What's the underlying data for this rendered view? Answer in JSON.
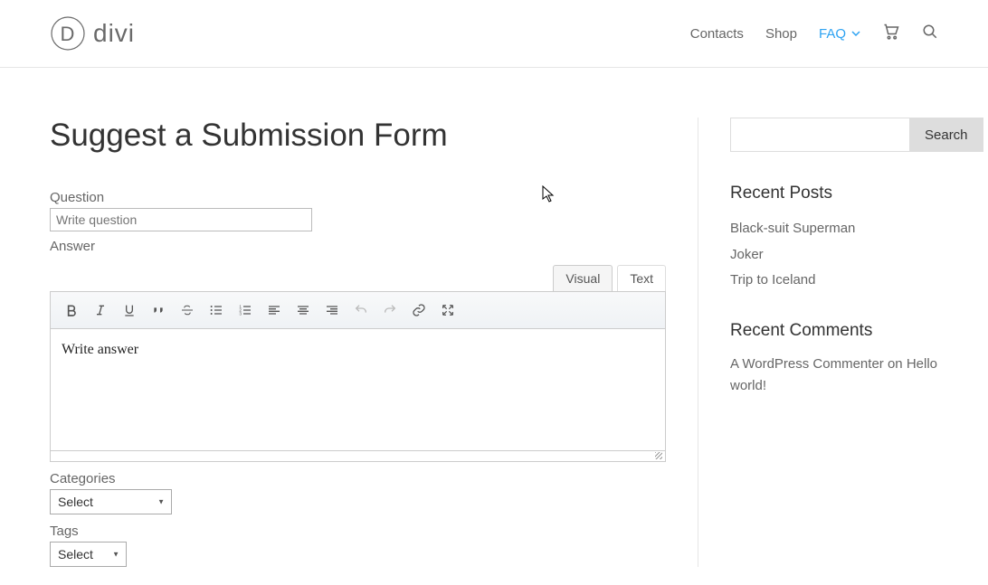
{
  "header": {
    "logo_text": "divi",
    "nav": [
      {
        "label": "Contacts",
        "active": false
      },
      {
        "label": "Shop",
        "active": false
      },
      {
        "label": "FAQ",
        "active": true,
        "has_dropdown": true
      }
    ]
  },
  "page": {
    "title": "Suggest a Submission Form",
    "question": {
      "label": "Question",
      "placeholder": "Write question"
    },
    "answer": {
      "label": "Answer",
      "placeholder": "Write answer",
      "tabs": {
        "visual": "Visual",
        "text": "Text"
      }
    },
    "categories": {
      "label": "Categories",
      "selected": "Select"
    },
    "tags": {
      "label": "Tags",
      "selected": "Select"
    }
  },
  "sidebar": {
    "search_button": "Search",
    "recent_posts": {
      "title": "Recent Posts",
      "items": [
        "Black-suit Superman",
        "Joker",
        "Trip to Iceland"
      ]
    },
    "recent_comments": {
      "title": "Recent Comments",
      "item_author": "A WordPress Commenter",
      "item_on": " on ",
      "item_post": "Hello world!"
    }
  }
}
